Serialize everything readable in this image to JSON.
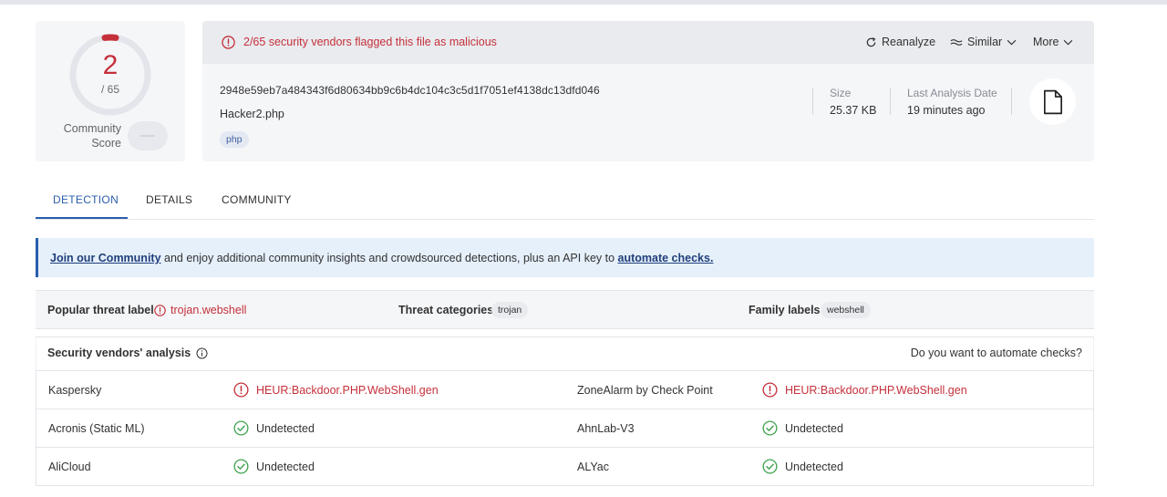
{
  "score": {
    "detections": "2",
    "total": "/ 65",
    "community_label_line1": "Community",
    "community_label_line2": "Score"
  },
  "alert": {
    "text": "2/65 security vendors flagged this file as malicious",
    "color": "#c5303a"
  },
  "actions": {
    "reanalyze": "Reanalyze",
    "similar": "Similar",
    "more": "More"
  },
  "file": {
    "hash": "2948e59eb7a484343f6d80634bb9c6b4dc104c3c5d1f7051ef4138dc13dfd046",
    "name": "Hacker2.php",
    "tag": "php",
    "size_label": "Size",
    "size_value": "25.37 KB",
    "date_label": "Last Analysis Date",
    "date_value": "19 minutes ago",
    "icon": "file-icon"
  },
  "tabs": [
    {
      "label": "DETECTION",
      "active": true
    },
    {
      "label": "DETAILS",
      "active": false
    },
    {
      "label": "COMMUNITY",
      "active": false
    }
  ],
  "banner": {
    "link1": "Join our Community",
    "middle": " and enjoy additional community insights and crowdsourced detections, plus an API key to ",
    "link2": "automate checks."
  },
  "threat": {
    "popular_label": "Popular threat label",
    "popular_value": "trojan.webshell",
    "categories_label": "Threat categories",
    "categories_value": "trojan",
    "family_label": "Family labels",
    "family_value": "webshell"
  },
  "vendors_header": {
    "title": "Security vendors' analysis",
    "right": "Do you want to automate checks?"
  },
  "vendors": [
    {
      "left_name": "Kaspersky",
      "left_result": "HEUR:Backdoor.PHP.WebShell.gen",
      "left_status": "malicious",
      "right_name": "ZoneAlarm by Check Point",
      "right_result": "HEUR:Backdoor.PHP.WebShell.gen",
      "right_status": "malicious"
    },
    {
      "left_name": "Acronis (Static ML)",
      "left_result": "Undetected",
      "left_status": "undetected",
      "right_name": "AhnLab-V3",
      "right_result": "Undetected",
      "right_status": "undetected"
    },
    {
      "left_name": "AliCloud",
      "left_result": "Undetected",
      "left_status": "undetected",
      "right_name": "ALYac",
      "right_result": "Undetected",
      "right_status": "undetected"
    }
  ],
  "colors": {
    "malicious": "#c5303a",
    "undetected": "#3fa34d",
    "accent": "#2a5dab"
  }
}
